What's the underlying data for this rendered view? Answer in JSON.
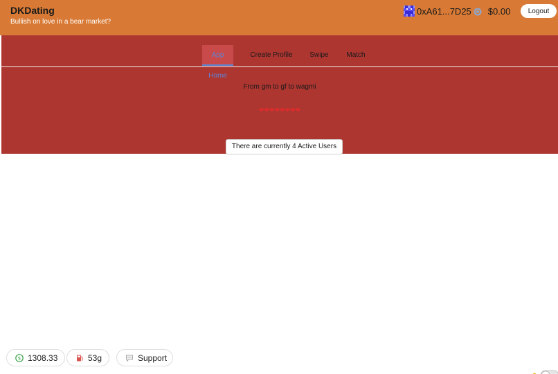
{
  "header": {
    "app_title": "DKDating",
    "tagline": "Bullish on love in a bear market?",
    "wallet_address": "0xA61...7D25",
    "balance": "$0.00",
    "logout_label": "Logout"
  },
  "nav": {
    "tabs": [
      {
        "label": "App Home",
        "active": true
      },
      {
        "label": "Create Profile",
        "active": false
      },
      {
        "label": "Swipe",
        "active": false
      },
      {
        "label": "Match",
        "active": false
      }
    ]
  },
  "main": {
    "subtitle": "From gm to gf to wagmi",
    "hearts": "❤❤❤❤❤❤❤❤",
    "active_users": "There are currently 4 Active Users"
  },
  "footer": {
    "balance_value": "1308.33",
    "gas_value": "53g",
    "support_label": "Support"
  },
  "colors": {
    "header_bg": "#d87a35",
    "panel_bg": "#ad3631",
    "active_tab_text": "#5b86d8"
  },
  "icons": {
    "wallet_avatar": "pixel-avatar-icon",
    "token": "eth-token-icon",
    "balance": "dollar-coin-icon",
    "gas": "gas-pump-icon",
    "support": "chat-bubble-icon",
    "theme": "sun-icon"
  }
}
